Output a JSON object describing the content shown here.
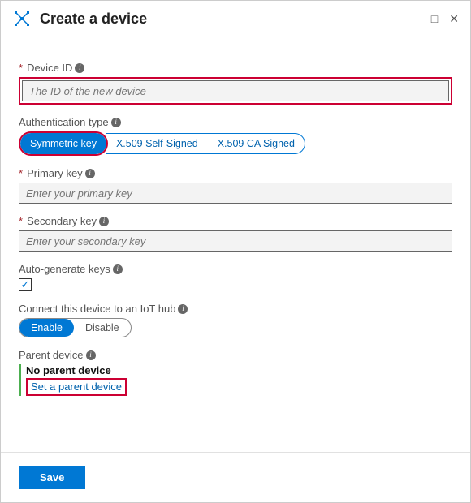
{
  "header": {
    "title": "Create a device"
  },
  "device_id": {
    "label": "Device ID",
    "placeholder": "The ID of the new device"
  },
  "auth": {
    "label": "Authentication type",
    "options": [
      "Symmetric key",
      "X.509 Self-Signed",
      "X.509 CA Signed"
    ],
    "selected": "Symmetric key"
  },
  "primary_key": {
    "label": "Primary key",
    "placeholder": "Enter your primary key"
  },
  "secondary_key": {
    "label": "Secondary key",
    "placeholder": "Enter your secondary key"
  },
  "autogen": {
    "label": "Auto-generate keys",
    "checked": true,
    "check_glyph": "✓"
  },
  "connect": {
    "label": "Connect this device to an IoT hub",
    "options": [
      "Enable",
      "Disable"
    ],
    "selected": "Enable"
  },
  "parent": {
    "label": "Parent device",
    "status": "No parent device",
    "link": "Set a parent device"
  },
  "footer": {
    "save": "Save"
  },
  "glyphs": {
    "info": "i",
    "maximize": "□",
    "close": "✕"
  }
}
